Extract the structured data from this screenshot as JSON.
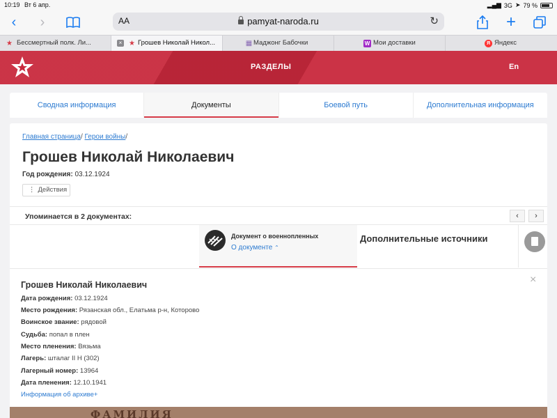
{
  "status_bar": {
    "time": "10:19",
    "date": "Вт 6 апр.",
    "network": "3G",
    "battery": "79 %",
    "battery_level": 0.79
  },
  "browser": {
    "address_aa": "AA",
    "url": "pamyat-naroda.ru",
    "tabs": [
      {
        "label": "Бессмертный полк. Ли...",
        "icon": "star-icon",
        "color": "#d63b47"
      },
      {
        "label": "Грошев Николай Никол...",
        "icon": "star-icon",
        "color": "#d63b47",
        "active": true
      },
      {
        "label": "Маджонг Бабочки",
        "icon": "mahjong-icon",
        "color": "#8a6bb5"
      },
      {
        "label": "Мои доставки",
        "icon": "w-icon",
        "color": "#a12ac7",
        "glyph": "W"
      },
      {
        "label": "Яндекс",
        "icon": "yandex-icon",
        "color": "#f33",
        "glyph": "Я"
      }
    ]
  },
  "site": {
    "sections": "РАЗДЕЛЫ",
    "lang": "En",
    "accent": "#c8283c",
    "nav": [
      "Сводная информация",
      "Документы",
      "Боевой путь",
      "Дополнительная информация"
    ]
  },
  "page": {
    "breadcrumb": [
      "Главная страница",
      "Герои войны"
    ],
    "title": "Грошев Николай Николаевич",
    "birth_label": "Год рождения:",
    "birth_value": "03.12.1924",
    "actions": "Действия",
    "mentions": "Упоминается в 2 документах:",
    "pager_prev": "‹",
    "pager_next": "›",
    "doc_title": "Документ о военнопленных",
    "doc_about": "О документе",
    "extra_sources": "Дополнительные источники"
  },
  "details": {
    "name": "Грошев Николай Николаевич",
    "rows": [
      {
        "label": "Дата рождения:",
        "value": "03.12.1924"
      },
      {
        "label": "Место рождения:",
        "value": "Рязанская обл., Елатьма р-н, Которово"
      },
      {
        "label": "Воинское звание:",
        "value": "рядовой"
      },
      {
        "label": "Судьба:",
        "value": "попал в плен"
      },
      {
        "label": "Место пленения:",
        "value": "Вязьма"
      },
      {
        "label": "Лагерь:",
        "value": "шталаг II H (302)"
      },
      {
        "label": "Лагерный номер:",
        "value": "13964"
      },
      {
        "label": "Дата пленения:",
        "value": "12.10.1941"
      }
    ],
    "archive_link": "Информация об архиве+"
  },
  "document_peek": "ФАМИЛИЯ"
}
